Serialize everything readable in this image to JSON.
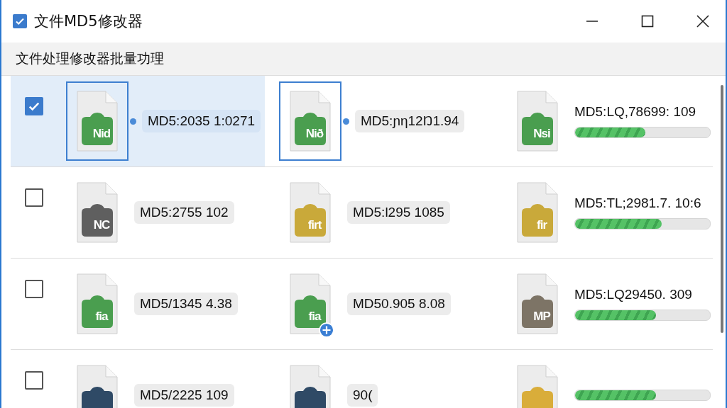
{
  "window": {
    "title": "文件MD5修改器",
    "checked": true
  },
  "toolbar": {
    "title": "文件处理修改器批量功理"
  },
  "rows": [
    {
      "selected": true,
      "checked": true,
      "cells": [
        {
          "kind": "hash",
          "badge": "Nid",
          "color": "#4a9e4f",
          "selected": true,
          "label": "MD5:2035 1:0271",
          "plus": false
        },
        {
          "kind": "hash",
          "badge": "Nið",
          "color": "#4a9e4f",
          "selected": true,
          "label": "MD5:ɲη12Ŋ1.94",
          "plus": false
        },
        {
          "kind": "progress",
          "badge": "Nsi",
          "color": "#4a9e4f",
          "selected": false,
          "label": "MD5:LQ,78699: 109",
          "level": 0.52
        }
      ]
    },
    {
      "selected": false,
      "checked": false,
      "cells": [
        {
          "kind": "hash",
          "badge": "NC",
          "color": "#5f5f5f",
          "selected": false,
          "label": "MD5:2755 102",
          "plus": false
        },
        {
          "kind": "hash",
          "badge": "firt",
          "color": "#c9a93a",
          "selected": false,
          "label": "MD5:l295 1085",
          "plus": false
        },
        {
          "kind": "progress",
          "badge": "fir",
          "color": "#c9a93a",
          "selected": false,
          "label": "MD5:TL;2981.7. 10:6",
          "level": 0.64
        }
      ]
    },
    {
      "selected": false,
      "checked": false,
      "cells": [
        {
          "kind": "hash",
          "badge": "fia",
          "color": "#4a9e4f",
          "selected": false,
          "label": "MD5/1345 4.38",
          "plus": false
        },
        {
          "kind": "hash",
          "badge": "fia",
          "color": "#4a9e4f",
          "selected": false,
          "label": "MD50.905 8.08",
          "plus": true
        },
        {
          "kind": "progress",
          "badge": "MP",
          "color": "#7d7466",
          "selected": false,
          "label": "MD5:LQ29450. 309",
          "level": 0.6
        }
      ]
    },
    {
      "selected": false,
      "checked": false,
      "cells": [
        {
          "kind": "hash",
          "color": "#2f4a66",
          "selected": false,
          "label": "MD5/2225 109",
          "plus": false
        },
        {
          "kind": "hash",
          "color": "#2f4a66",
          "selected": false,
          "label": "90(",
          "plus": false
        },
        {
          "kind": "progress",
          "color": "#d9ad3a",
          "selected": false,
          "level": 0.6
        }
      ]
    }
  ]
}
